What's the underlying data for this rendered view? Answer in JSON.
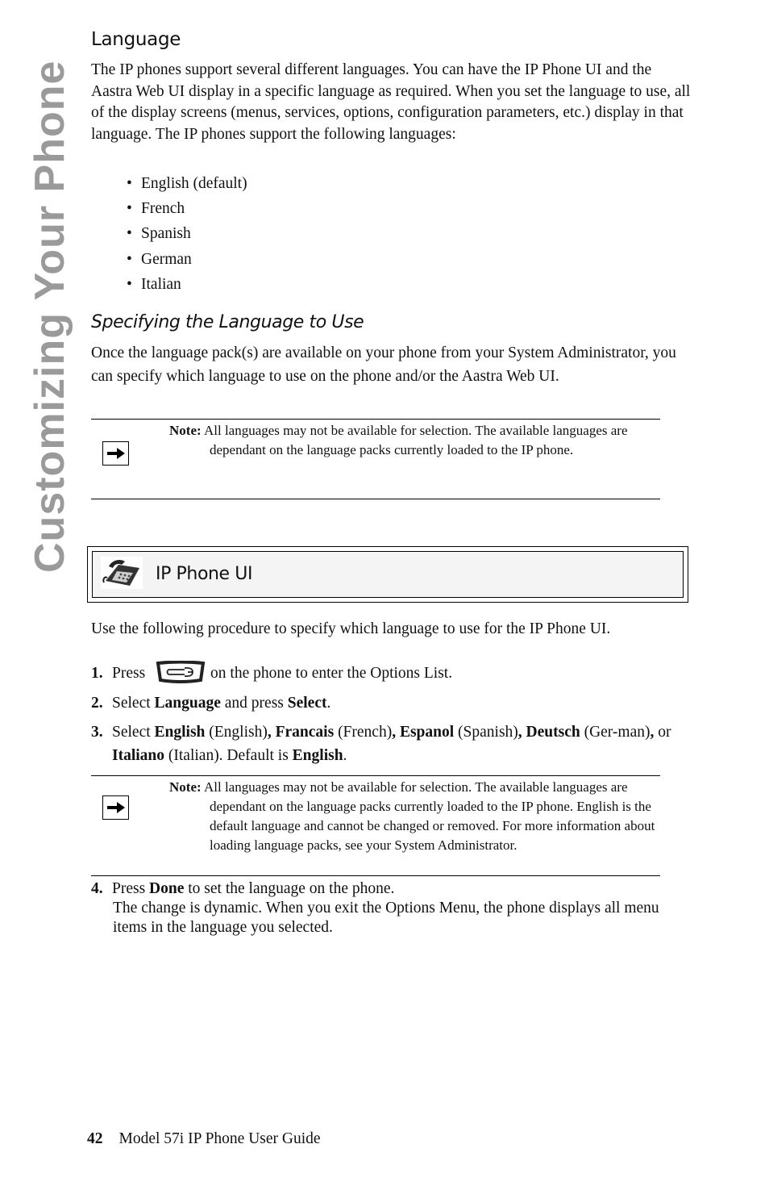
{
  "side_tab": "Customizing Your Phone",
  "section": {
    "heading": "Language",
    "intro": "The IP phones support several different languages. You can have the IP Phone UI and the Aastra Web UI display in a specific language as required. When you set the language to use, all of the display screens (menus, services, options, configuration parameters, etc.) display in that language. The IP phones support the following languages:",
    "languages": [
      "English (default)",
      "French",
      "Spanish",
      "German",
      "Italian"
    ]
  },
  "subsection": {
    "heading": "Specifying the Language to Use",
    "intro": "Once the language pack(s) are available on your phone from your System Administrator, you can specify which language to use on the phone and/or the Aastra Web UI."
  },
  "note1": {
    "label": "Note:",
    "text": "All languages may not be available for selection. The available languages are dependant on the language packs currently loaded to the IP phone."
  },
  "ip_phone_ui": {
    "title": "IP Phone UI",
    "icon": "desk-phone-icon",
    "intro": "Use the following procedure to specify which language to use for the IP Phone UI.",
    "steps": [
      {
        "num": "1.",
        "pre": "Press",
        "key_icon": "options-key-icon",
        "post": "on the phone to enter the Options List."
      },
      {
        "num": "2.",
        "t1": "Select ",
        "b1": "Language",
        "t2": " and press ",
        "b2": "Select",
        "t3": "."
      },
      {
        "num": "3.",
        "t1": "Select ",
        "b1": "English",
        "t2": " (English)",
        "b2": ", Francais",
        "t3": " (French)",
        "b3": ", Espanol",
        "t4": " (Spanish)",
        "b4": ", Deutsch",
        "t5": " (Ger-man)",
        "b5": ",",
        "t6": " or ",
        "b6": "Italiano",
        "t7": " (Italian). Default is ",
        "b7": "English",
        "t8": "."
      },
      {
        "num": "4.",
        "t1": "Press ",
        "b1": "Done",
        "t2": " to set the language on the phone.",
        "detail": "The change is dynamic. When you exit the Options Menu, the phone displays all menu items in the language you selected."
      }
    ]
  },
  "note2": {
    "label": "Note:",
    "text": "All languages may not be available for selection. The available languages are dependant on the language packs currently loaded to the IP phone. English is the default language and cannot be changed or removed. For more information about loading language packs, see your System Administrator."
  },
  "footer": {
    "page_number": "42",
    "title": "Model 57i IP Phone User Guide"
  }
}
